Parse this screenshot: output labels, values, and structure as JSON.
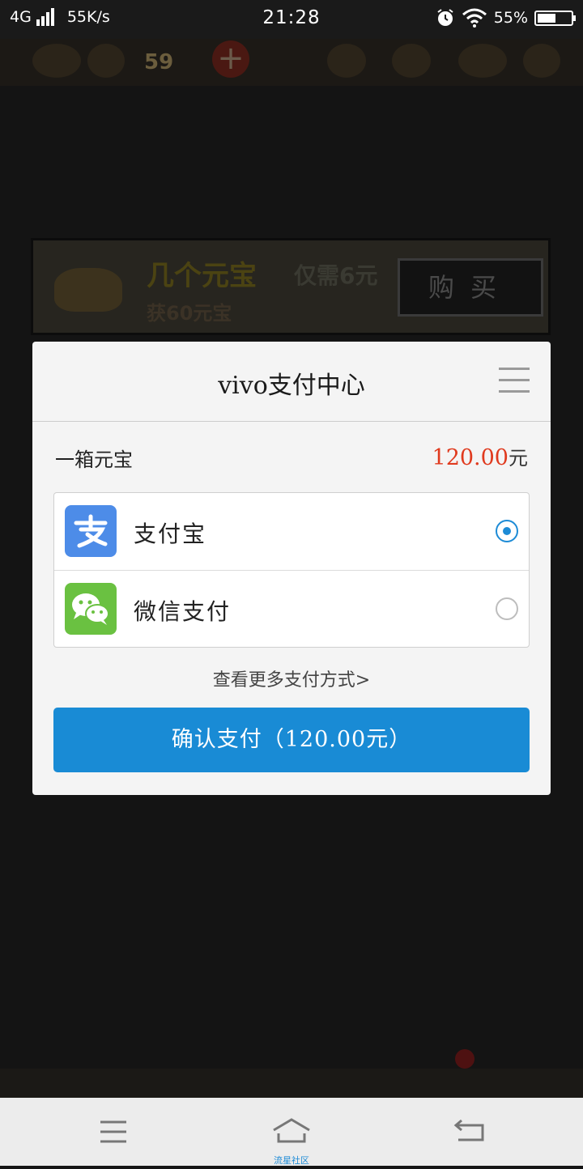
{
  "status_bar": {
    "network": "4G",
    "speed": "55K/s",
    "time": "21:28",
    "battery": "55%",
    "battery_level": 0.55,
    "icons": [
      "signal-icon",
      "alarm-icon",
      "wifi-icon",
      "battery-icon"
    ]
  },
  "background_game": {
    "top_number": "59",
    "rows": [
      {
        "name": "几个元宝",
        "price": "仅需6元",
        "sub": "获60元宝",
        "buy": "购买"
      }
    ]
  },
  "dialog": {
    "title": "vivo支付中心",
    "item_name": "一箱元宝",
    "item_price": "120.00",
    "item_unit": "元",
    "methods": [
      {
        "label": "支付宝",
        "icon": "alipay-icon",
        "selected": true,
        "color": "#4d8ce8"
      },
      {
        "label": "微信支付",
        "icon": "wechat-icon",
        "selected": false,
        "color": "#6ac141"
      }
    ],
    "more_link": "查看更多支付方式>",
    "confirm_label": "确认支付（120.00元）"
  },
  "nav_bar": {
    "home_label": "流星社区",
    "icons": [
      "menu-icon",
      "home-icon",
      "back-icon"
    ]
  },
  "colors": {
    "accent": "#198bd5",
    "price": "#e03a1e",
    "overlay": "#151515"
  }
}
